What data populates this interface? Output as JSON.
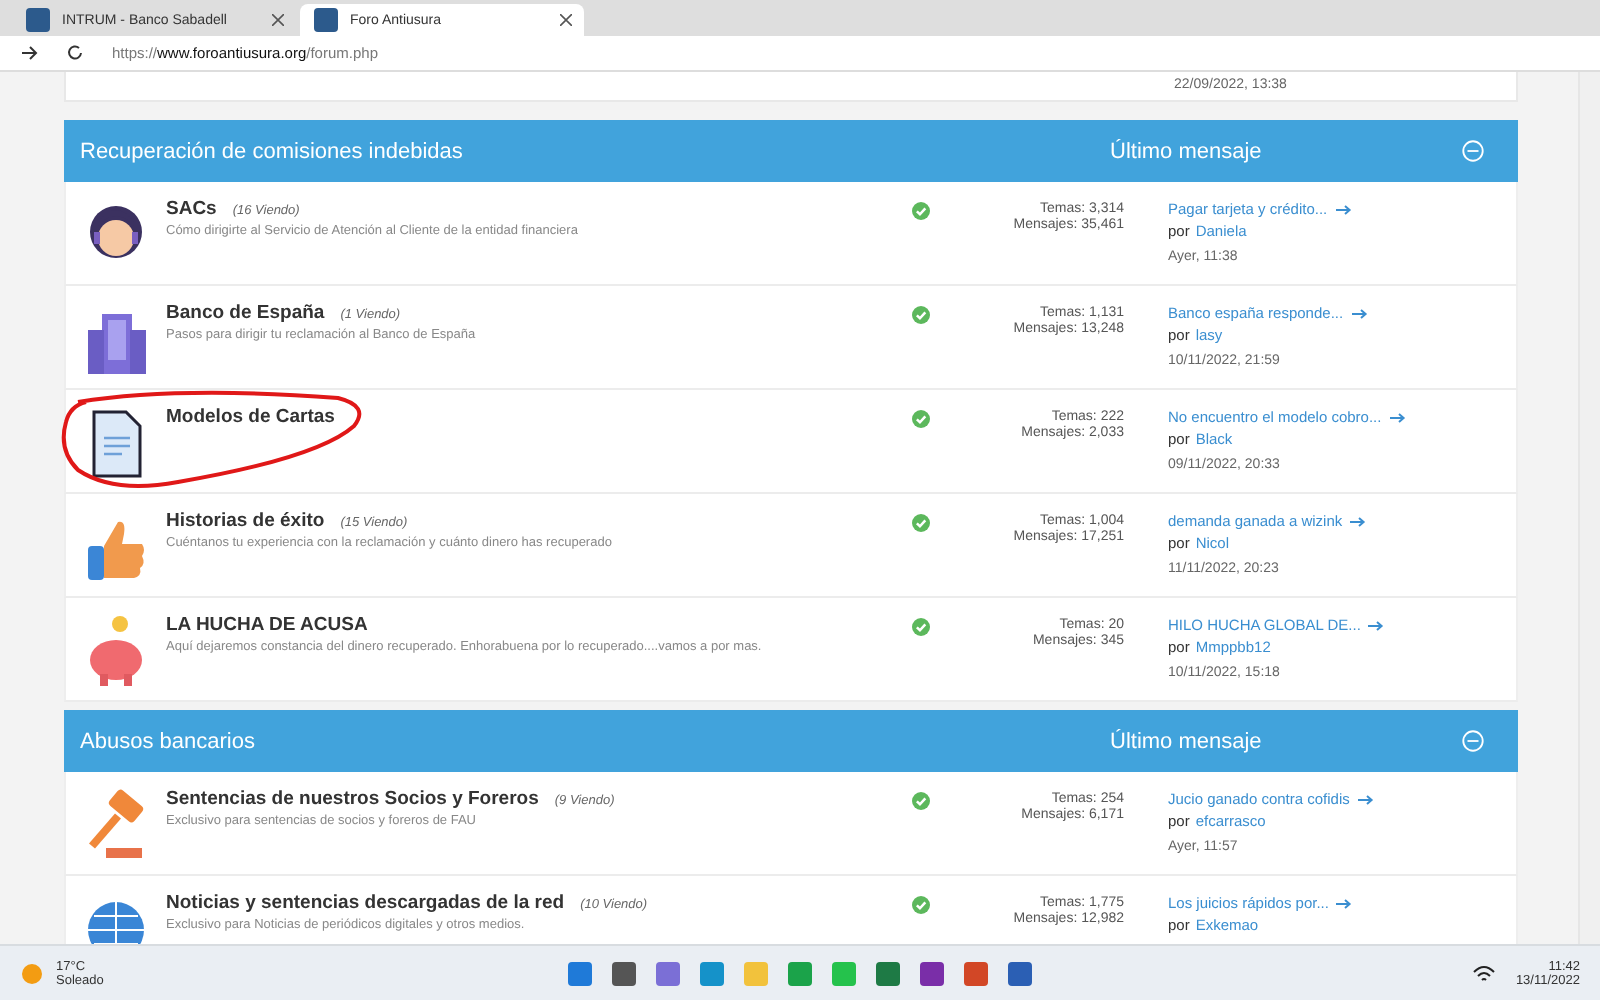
{
  "browser": {
    "tabs": [
      {
        "title": "INTRUM - Banco Sabadell",
        "selected": false
      },
      {
        "title": "Foro Antiusura",
        "selected": true
      }
    ],
    "url_scheme": "https://",
    "url_host": "www.foroantiusura.org",
    "url_path": "/forum.php"
  },
  "previous_row": {
    "last_date": "22/09/2022, 13:38"
  },
  "categories": [
    {
      "title": "Recuperación de comisiones indebidas",
      "last_header": "Último mensaje",
      "forums": [
        {
          "kind": "agent",
          "name": "SACs",
          "viewing": "(16 Viendo)",
          "description": "Cómo dirigirte al Servicio de Atención al Cliente de la entidad financiera",
          "topics": "Temas: 3,314",
          "posts": "Mensajes: 35,461",
          "last_title": "Pagar tarjeta y crédito...",
          "by": "por",
          "user": "Daniela",
          "date": "Ayer, 11:38",
          "annotated": false
        },
        {
          "kind": "building",
          "name": "Banco de España",
          "viewing": "(1 Viendo)",
          "description": "Pasos para dirigir tu reclamación al Banco de España",
          "topics": "Temas: 1,131",
          "posts": "Mensajes: 13,248",
          "last_title": "Banco españa responde...",
          "by": "por",
          "user": "lasy",
          "date": "10/11/2022, 21:59",
          "annotated": false
        },
        {
          "kind": "document",
          "name": "Modelos de Cartas",
          "topics": "Temas: 222",
          "posts": "Mensajes: 2,033",
          "last_title": "No encuentro el modelo cobro...",
          "by": "por",
          "user": "Black",
          "date": "09/11/2022, 20:33",
          "annotated": true
        },
        {
          "kind": "thumb",
          "name": "Historias de éxito",
          "viewing": "(15 Viendo)",
          "description": "Cuéntanos tu experiencia con la reclamación y cuánto dinero has recuperado",
          "topics": "Temas: 1,004",
          "posts": "Mensajes: 17,251",
          "last_title": "demanda ganada a wizink",
          "by": "por",
          "user": "Nicol",
          "date": "11/11/2022, 20:23",
          "annotated": false
        },
        {
          "kind": "piggy",
          "name": "LA HUCHA DE ACUSA",
          "description": "Aquí dejaremos constancia del dinero recuperado. Enhorabuena por lo recuperado....vamos a por mas.",
          "topics": "Temas: 20",
          "posts": "Mensajes: 345",
          "last_title": "HILO HUCHA GLOBAL DE...",
          "by": "por",
          "user": "Mmppbb12",
          "date": "10/11/2022, 15:18",
          "annotated": false
        }
      ]
    },
    {
      "title": "Abusos bancarios",
      "last_header": "Último mensaje",
      "forums": [
        {
          "kind": "gavel",
          "name": "Sentencias de nuestros Socios y Foreros",
          "viewing": "(9 Viendo)",
          "description": "Exclusivo para sentencias de socios y foreros de FAU",
          "topics": "Temas: 254",
          "posts": "Mensajes: 6,171",
          "last_title": "Jucio ganado contra cofidis",
          "by": "por",
          "user": "efcarrasco",
          "date": "Ayer, 11:57",
          "annotated": false
        },
        {
          "kind": "globe",
          "name": "Noticias y sentencias descargadas de la red",
          "viewing": "(10 Viendo)",
          "description": "Exclusivo para Noticias de periódicos digitales y otros medios.",
          "topics": "Temas: 1,775",
          "posts": "Mensajes: 12,982",
          "last_title": "Los juicios rápidos por...",
          "by": "por",
          "user": "Exkemao",
          "annotated": false
        }
      ]
    }
  ],
  "taskbar": {
    "temperature": "17°C",
    "weather": "Soleado",
    "time": "11:42",
    "date": "13/11/2022"
  }
}
